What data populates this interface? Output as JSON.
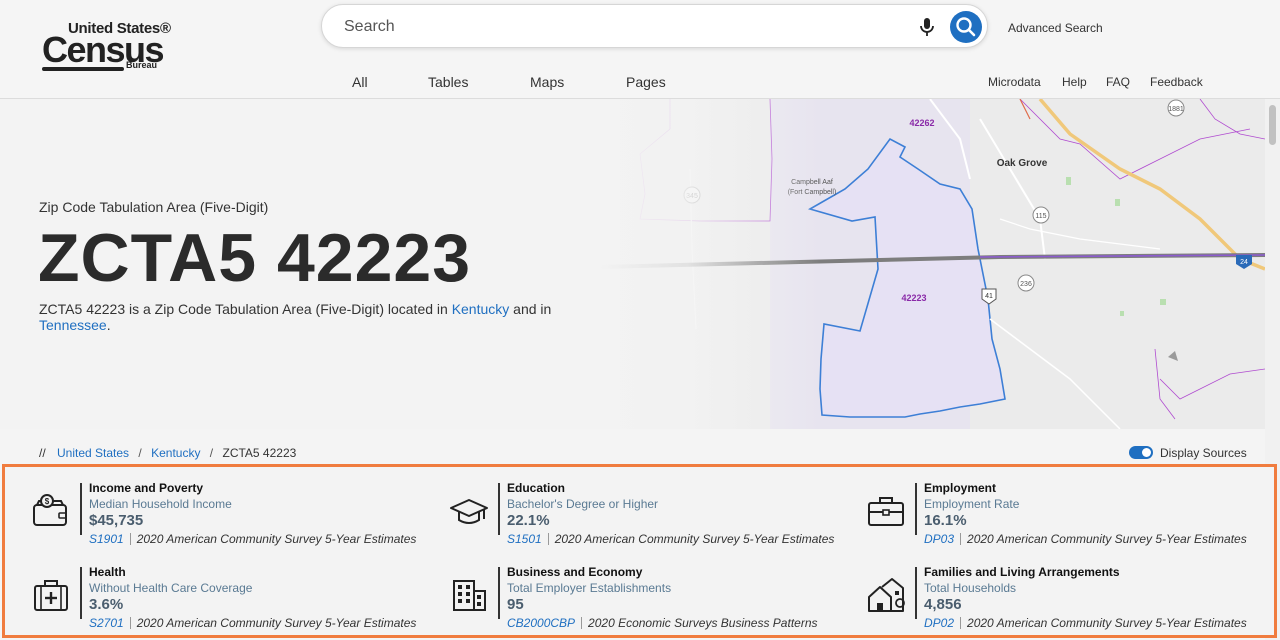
{
  "header": {
    "logo": {
      "line1": "United States®",
      "line2": "Census",
      "line3": "Bureau"
    },
    "search_placeholder": "Search",
    "advanced_search": "Advanced Search",
    "tabs": [
      {
        "label": "All"
      },
      {
        "label": "Tables"
      },
      {
        "label": "Maps"
      },
      {
        "label": "Pages"
      }
    ],
    "links": [
      {
        "label": "Microdata"
      },
      {
        "label": "Help"
      },
      {
        "label": "FAQ"
      },
      {
        "label": "Feedback"
      }
    ]
  },
  "hero": {
    "subtitle": "Zip Code Tabulation Area (Five-Digit)",
    "title": "ZCTA5 42223",
    "desc_prefix": "ZCTA5 42223 is a Zip Code Tabulation Area (Five-Digit) located in ",
    "desc_link1": "Kentucky",
    "desc_mid": " and in ",
    "desc_link2": "Tennessee",
    "desc_suffix": "."
  },
  "map": {
    "labels": {
      "zcta_north": "42262",
      "zcta_center": "42223",
      "town": "Oak Grove",
      "base_line1": "Campbell Aaf",
      "base_line2": "(Fort Campbell)",
      "route_345": "345",
      "route_115": "115",
      "route_41": "41",
      "route_236": "236",
      "route_1881": "1881",
      "interstate": "24"
    },
    "colors": {
      "boundary": "#3d7fd6",
      "zcta_fill": "#ece8f6",
      "county_line": "#b04cd0",
      "highway": "#7d7d7d",
      "interstate_route": "#e6b45a"
    }
  },
  "breadcrumb": {
    "prefix": "//",
    "items": [
      {
        "label": "United States"
      },
      {
        "label": "Kentucky"
      }
    ],
    "current": "ZCTA5 42223"
  },
  "display_sources": {
    "label": "Display Sources",
    "enabled": true
  },
  "stats": [
    {
      "icon": "wallet-icon",
      "category": "Income and Poverty",
      "metric": "Median Household Income",
      "value": "$45,735",
      "code": "S1901",
      "source": "2020 American Community Survey 5-Year Estimates"
    },
    {
      "icon": "graduation-cap-icon",
      "category": "Education",
      "metric": "Bachelor's Degree or Higher",
      "value": "22.1%",
      "code": "S1501",
      "source": "2020 American Community Survey 5-Year Estimates"
    },
    {
      "icon": "briefcase-icon",
      "category": "Employment",
      "metric": "Employment Rate",
      "value": "16.1%",
      "code": "DP03",
      "source": "2020 American Community Survey 5-Year Estimates"
    },
    {
      "icon": "medical-kit-icon",
      "category": "Health",
      "metric": "Without Health Care Coverage",
      "value": "3.6%",
      "code": "S2701",
      "source": "2020 American Community Survey 5-Year Estimates"
    },
    {
      "icon": "building-icon",
      "category": "Business and Economy",
      "metric": "Total Employer Establishments",
      "value": "95",
      "code": "CB2000CBP",
      "source": "2020 Economic Surveys Business Patterns"
    },
    {
      "icon": "houses-icon",
      "category": "Families and Living Arrangements",
      "metric": "Total Households",
      "value": "4,856",
      "code": "DP02",
      "source": "2020 American Community Survey 5-Year Estimates"
    }
  ],
  "accent_color": "#f07c3e",
  "link_color": "#1f6fc1"
}
